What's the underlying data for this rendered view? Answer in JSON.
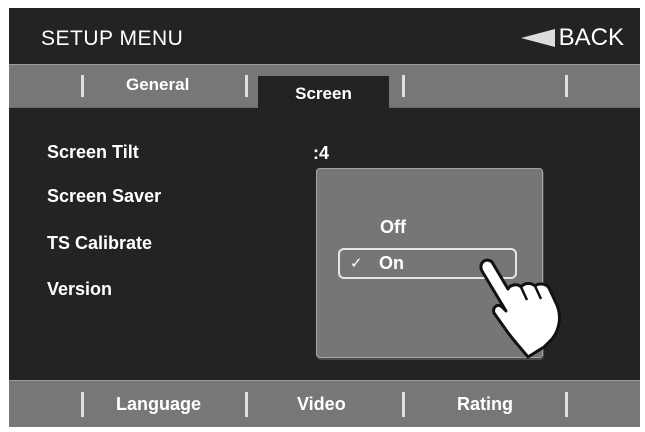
{
  "header": {
    "title": "SETUP MENU",
    "back_label": "BACK",
    "back_icon": "back-arrow-icon"
  },
  "tabs": [
    {
      "label": "General",
      "active": false
    },
    {
      "label": "Screen",
      "active": true
    }
  ],
  "settings": [
    {
      "label": "Screen Tilt",
      "value": ":4"
    },
    {
      "label": "Screen Saver"
    },
    {
      "label": "TS Calibrate"
    },
    {
      "label": "Version"
    }
  ],
  "popup": {
    "options": [
      "Off",
      "On"
    ],
    "selected": "On",
    "check_icon": "checkmark-icon"
  },
  "pointer": {
    "icon": "pointing-hand-icon"
  },
  "bottom_tabs": [
    {
      "label": "Language"
    },
    {
      "label": "Video"
    },
    {
      "label": "Rating"
    }
  ],
  "colors": {
    "background": "#232323",
    "bar": "#777777",
    "popup": "#767676",
    "text": "#ffffff"
  }
}
